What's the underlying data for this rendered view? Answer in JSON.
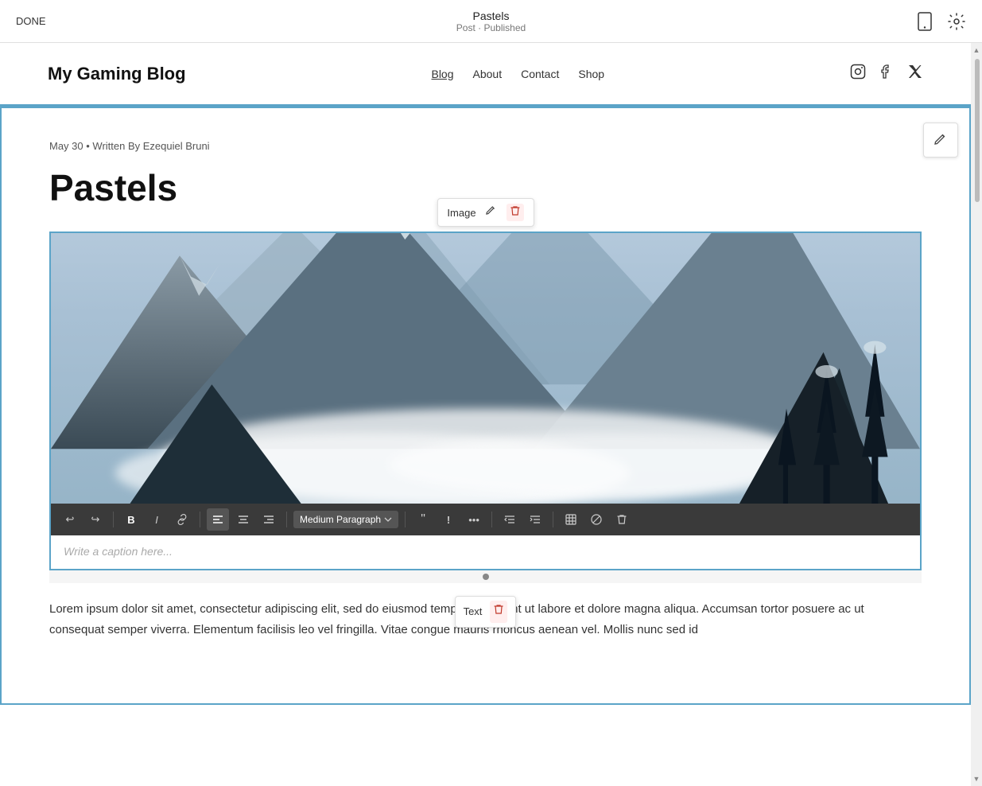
{
  "topbar": {
    "done_label": "DONE",
    "post_title": "Pastels",
    "post_status": "Post · Published"
  },
  "site": {
    "logo": "My Gaming Blog",
    "nav_links": [
      {
        "label": "Blog",
        "active": true
      },
      {
        "label": "About",
        "active": false
      },
      {
        "label": "Contact",
        "active": false
      },
      {
        "label": "Shop",
        "active": false
      }
    ]
  },
  "post": {
    "meta": "May 30  •  Written By Ezequiel Bruni",
    "title": "Pastels",
    "image_label": "Image",
    "caption_placeholder": "Write a caption here...",
    "body_text": "Lorem ipsum dolor sit amet, consectetur adipiscing elit, sed do eiusmod tempor incididunt ut labore et dolore magna aliqua. Accumsan tortor posuere ac ut consequat semper viverra. Elementum facilisis leo vel fringilla. Vitae congue mauris rhoncus aenean vel. Mollis nunc sed id",
    "text_label": "Text"
  },
  "toolbar": {
    "paragraph_style": "Medium Paragraph",
    "buttons": [
      "undo",
      "redo",
      "bold",
      "italic",
      "link",
      "align-left",
      "align-center",
      "align-right",
      "paragraph",
      "quote",
      "exclaim",
      "more",
      "outdent",
      "indent",
      "table",
      "no-format",
      "delete"
    ]
  },
  "icons": {
    "done": "DONE",
    "phone": "📱",
    "gear": "⚙",
    "instagram": "ⓘ",
    "facebook": "f",
    "twitter": "𝕏",
    "edit": "✏",
    "pencil": "✎",
    "trash": "🗑"
  }
}
